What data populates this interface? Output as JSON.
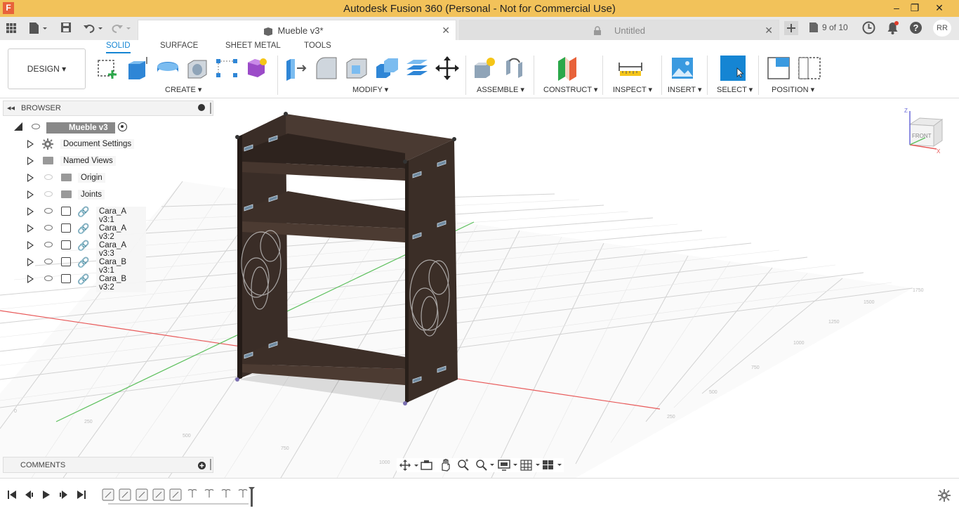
{
  "window": {
    "title": "Autodesk Fusion 360 (Personal - Not for Commercial Use)",
    "app_icon": "F"
  },
  "tabs": [
    {
      "label": "Mueble v3*",
      "active": true
    },
    {
      "label": "Untitled",
      "active": false
    }
  ],
  "job_status": "9 of 10",
  "user_initials": "RR",
  "workspace": {
    "label": "DESIGN"
  },
  "ribbon_tabs": [
    "SOLID",
    "SURFACE",
    "SHEET METAL",
    "TOOLS"
  ],
  "groups": {
    "create": "CREATE",
    "modify": "MODIFY",
    "assemble": "ASSEMBLE",
    "construct": "CONSTRUCT",
    "inspect": "INSPECT",
    "insert": "INSERT",
    "select": "SELECT",
    "position": "POSITION"
  },
  "browser": {
    "title": "BROWSER",
    "root": "Mueble v3",
    "items": [
      {
        "label": "Document Settings",
        "icon": "gear-icon"
      },
      {
        "label": "Named Views",
        "icon": "folder-icon"
      },
      {
        "label": "Origin",
        "icon": "folder-icon"
      },
      {
        "label": "Joints",
        "icon": "folder-icon"
      },
      {
        "label": "Cara_A v3:1",
        "icon": "component-icon"
      },
      {
        "label": "Cara_A v3:2",
        "icon": "component-icon"
      },
      {
        "label": "Cara_A v3:3",
        "icon": "component-icon"
      },
      {
        "label": "Cara_B v3:1",
        "icon": "component-icon"
      },
      {
        "label": "Cara_B v3:2",
        "icon": "component-icon"
      }
    ]
  },
  "comments": {
    "title": "COMMENTS"
  },
  "viewcube": {
    "face": "FRONT",
    "axis_z": "Z",
    "axis_x": "X"
  },
  "colors": {
    "accent": "#1585d3",
    "titlebar": "#f2c25a",
    "wood": "#3b2e27"
  }
}
